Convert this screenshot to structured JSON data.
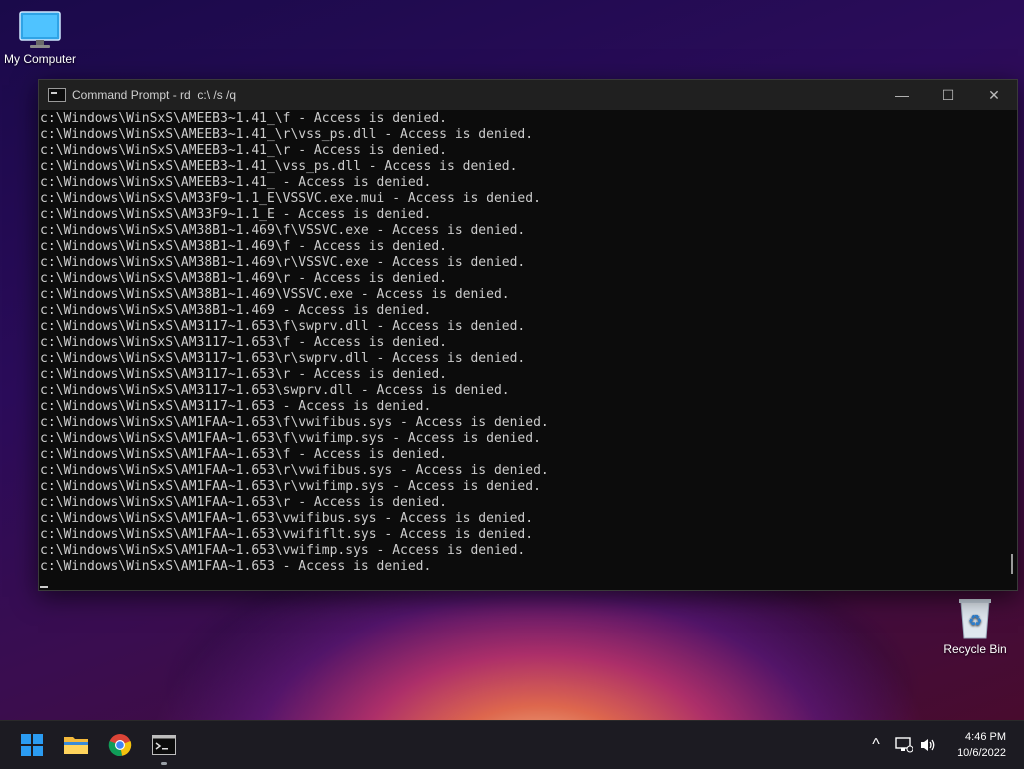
{
  "desktop": {
    "icons": [
      {
        "label": "My Computer"
      },
      {
        "label": "Recycle Bin"
      }
    ]
  },
  "window": {
    "title": "Command Prompt - rd  c:\\ /s /q",
    "console_lines": [
      "c:\\Windows\\WinSxS\\AMEEB3~1.41_\\f - Access is denied.",
      "c:\\Windows\\WinSxS\\AMEEB3~1.41_\\r\\vss_ps.dll - Access is denied.",
      "c:\\Windows\\WinSxS\\AMEEB3~1.41_\\r - Access is denied.",
      "c:\\Windows\\WinSxS\\AMEEB3~1.41_\\vss_ps.dll - Access is denied.",
      "c:\\Windows\\WinSxS\\AMEEB3~1.41_ - Access is denied.",
      "c:\\Windows\\WinSxS\\AM33F9~1.1_E\\VSSVC.exe.mui - Access is denied.",
      "c:\\Windows\\WinSxS\\AM33F9~1.1_E - Access is denied.",
      "c:\\Windows\\WinSxS\\AM38B1~1.469\\f\\VSSVC.exe - Access is denied.",
      "c:\\Windows\\WinSxS\\AM38B1~1.469\\f - Access is denied.",
      "c:\\Windows\\WinSxS\\AM38B1~1.469\\r\\VSSVC.exe - Access is denied.",
      "c:\\Windows\\WinSxS\\AM38B1~1.469\\r - Access is denied.",
      "c:\\Windows\\WinSxS\\AM38B1~1.469\\VSSVC.exe - Access is denied.",
      "c:\\Windows\\WinSxS\\AM38B1~1.469 - Access is denied.",
      "c:\\Windows\\WinSxS\\AM3117~1.653\\f\\swprv.dll - Access is denied.",
      "c:\\Windows\\WinSxS\\AM3117~1.653\\f - Access is denied.",
      "c:\\Windows\\WinSxS\\AM3117~1.653\\r\\swprv.dll - Access is denied.",
      "c:\\Windows\\WinSxS\\AM3117~1.653\\r - Access is denied.",
      "c:\\Windows\\WinSxS\\AM3117~1.653\\swprv.dll - Access is denied.",
      "c:\\Windows\\WinSxS\\AM3117~1.653 - Access is denied.",
      "c:\\Windows\\WinSxS\\AM1FAA~1.653\\f\\vwifibus.sys - Access is denied.",
      "c:\\Windows\\WinSxS\\AM1FAA~1.653\\f\\vwifimp.sys - Access is denied.",
      "c:\\Windows\\WinSxS\\AM1FAA~1.653\\f - Access is denied.",
      "c:\\Windows\\WinSxS\\AM1FAA~1.653\\r\\vwifibus.sys - Access is denied.",
      "c:\\Windows\\WinSxS\\AM1FAA~1.653\\r\\vwifimp.sys - Access is denied.",
      "c:\\Windows\\WinSxS\\AM1FAA~1.653\\r - Access is denied.",
      "c:\\Windows\\WinSxS\\AM1FAA~1.653\\vwifibus.sys - Access is denied.",
      "c:\\Windows\\WinSxS\\AM1FAA~1.653\\vwififlt.sys - Access is denied.",
      "c:\\Windows\\WinSxS\\AM1FAA~1.653\\vwifimp.sys - Access is denied.",
      "c:\\Windows\\WinSxS\\AM1FAA~1.653 - Access is denied."
    ],
    "buttons": {
      "minimize": "—",
      "maximize": "☐",
      "close": "✕"
    }
  },
  "taskbar": {
    "apps": [
      {
        "icon": "start-icon"
      },
      {
        "icon": "file-explorer-icon"
      },
      {
        "icon": "chrome-icon"
      },
      {
        "icon": "command-prompt-icon"
      }
    ],
    "tray": {
      "chevron_glyph": "^",
      "time": "4:46 PM",
      "date": "10/6/2022"
    }
  },
  "colors": {
    "console_bg": "#0c0c0c",
    "console_text": "#cccccc",
    "titlebar_bg": "#202020",
    "taskbar_bg": "#1c1b22",
    "start_blue": "#2b9cf2"
  }
}
